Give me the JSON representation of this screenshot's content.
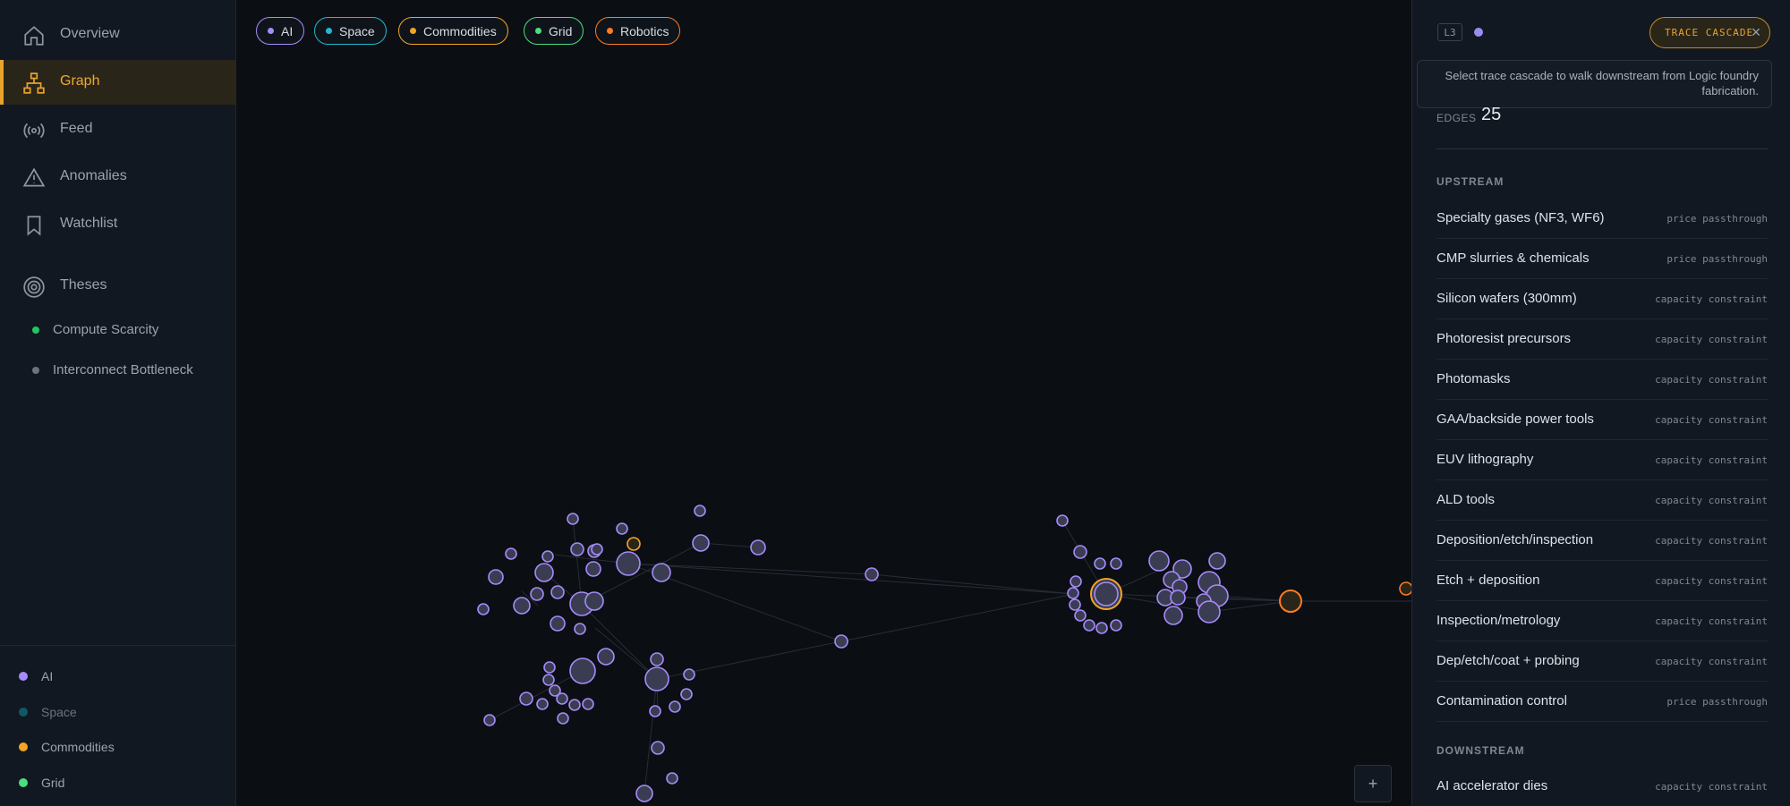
{
  "nav": {
    "items": [
      {
        "label": "Overview",
        "icon": "home-icon",
        "active": false
      },
      {
        "label": "Graph",
        "icon": "graph-icon",
        "active": true
      },
      {
        "label": "Feed",
        "icon": "broadcast-icon",
        "active": false
      },
      {
        "label": "Anomalies",
        "icon": "warning-icon",
        "active": false
      },
      {
        "label": "Watchlist",
        "icon": "bookmark-icon",
        "active": false
      },
      {
        "label": "Theses",
        "icon": "target-icon",
        "active": false
      }
    ],
    "theses": [
      {
        "label": "Compute Scarcity",
        "color": "#22c55e"
      },
      {
        "label": "Interconnect Bottleneck",
        "color": "#6b7280"
      }
    ]
  },
  "legend": [
    {
      "label": "AI",
      "color": "#a78bfa"
    },
    {
      "label": "Space",
      "color": "#0e5a66"
    },
    {
      "label": "Commodities",
      "color": "#f5a524"
    },
    {
      "label": "Grid",
      "color": "#4ade80"
    }
  ],
  "filters": [
    {
      "label": "AI",
      "color": "#a78bfa"
    },
    {
      "label": "Space",
      "color": "#22b8cf"
    },
    {
      "label": "Commodities",
      "color": "#f5a524"
    },
    {
      "label": "Grid",
      "color": "#4ade80"
    },
    {
      "label": "Robotics",
      "color": "#fb7c24"
    }
  ],
  "panel": {
    "level": "L3",
    "level_color": "#9b8cf0",
    "trace_label": "TRACE CASCADE",
    "tooltip": "Select trace cascade to walk downstream from Logic foundry fabrication.",
    "edges_label": "EDGES",
    "edges_value": "25",
    "upstream_title": "UPSTREAM",
    "upstream": [
      {
        "name": "Specialty gases (NF3, WF6)",
        "tag": "price passthrough"
      },
      {
        "name": "CMP slurries & chemicals",
        "tag": "price passthrough"
      },
      {
        "name": "Silicon wafers (300mm)",
        "tag": "capacity constraint"
      },
      {
        "name": "Photoresist precursors",
        "tag": "capacity constraint"
      },
      {
        "name": "Photomasks",
        "tag": "capacity constraint"
      },
      {
        "name": "GAA/backside power tools",
        "tag": "capacity constraint"
      },
      {
        "name": "EUV lithography",
        "tag": "capacity constraint"
      },
      {
        "name": "ALD tools",
        "tag": "capacity constraint"
      },
      {
        "name": "Deposition/etch/inspection",
        "tag": "capacity constraint"
      },
      {
        "name": "Etch + deposition",
        "tag": "capacity constraint"
      },
      {
        "name": "Inspection/metrology",
        "tag": "capacity constraint"
      },
      {
        "name": "Dep/etch/coat + probing",
        "tag": "capacity constraint"
      },
      {
        "name": "Contamination control",
        "tag": "price passthrough"
      }
    ],
    "downstream_title": "DOWNSTREAM",
    "downstream": [
      {
        "name": "AI accelerator dies",
        "tag": "capacity constraint"
      }
    ]
  },
  "zoom_label": "+"
}
